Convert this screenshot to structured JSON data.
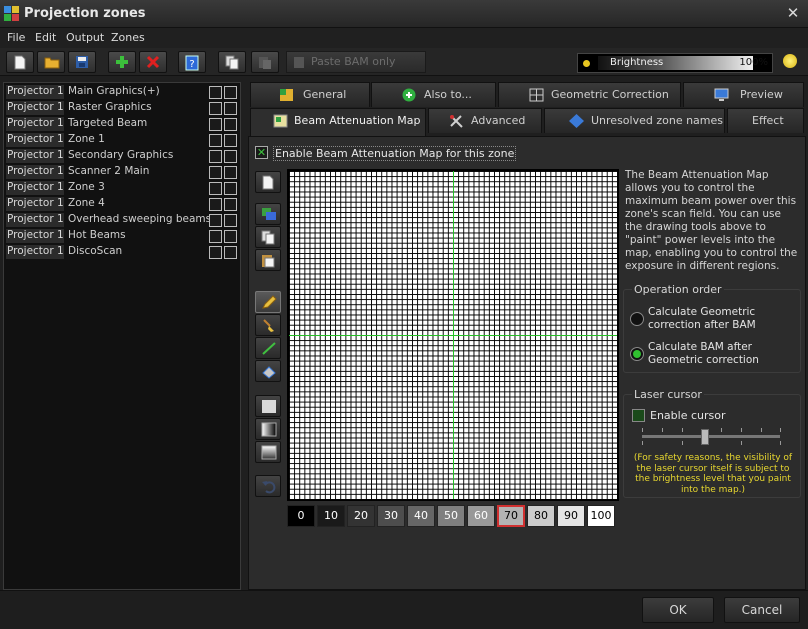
{
  "window": {
    "title": "Projection zones"
  },
  "menu": [
    "File",
    "Edit",
    "Output",
    "Zones"
  ],
  "toolbar": {
    "paste_bam_label": "Paste BAM only",
    "brightness_label": "Brightness",
    "brightness_percent": "100%",
    "brightness_value": 100
  },
  "zones": [
    {
      "projector": "Projector 1",
      "name": "Main Graphics(+)"
    },
    {
      "projector": "Projector 1",
      "name": "Raster Graphics"
    },
    {
      "projector": "Projector 1",
      "name": "Targeted Beam"
    },
    {
      "projector": "Projector 1",
      "name": "Zone 1"
    },
    {
      "projector": "Projector 1",
      "name": "Secondary Graphics"
    },
    {
      "projector": "Projector 1",
      "name": "Scanner 2 Main"
    },
    {
      "projector": "Projector 1",
      "name": "Zone 3"
    },
    {
      "projector": "Projector 1",
      "name": "Zone 4"
    },
    {
      "projector": "Projector 1",
      "name": "Overhead sweeping beams"
    },
    {
      "projector": "Projector 1",
      "name": "Hot Beams"
    },
    {
      "projector": "Projector 1",
      "name": "DiscoScan"
    }
  ],
  "tabs": {
    "row1": [
      "General",
      "Also to...",
      "Geometric Correction",
      "Preview"
    ],
    "row2": [
      "Beam Attenuation Map",
      "Advanced",
      "Unresolved zone names",
      "Effect"
    ],
    "active": "Beam Attenuation Map"
  },
  "bam": {
    "enable_label": "Enable Beam Attenuation Map for this zone",
    "enabled": true,
    "description": "The Beam Attenuation Map allows you to control the maximum beam power over this zone's scan field. You can use the drawing tools above to \"paint\" power levels into the map, enabling you to control the exposure in different regions.",
    "levels": [
      "0",
      "10",
      "20",
      "30",
      "40",
      "50",
      "60",
      "70",
      "80",
      "90",
      "100"
    ],
    "selected_level": "70"
  },
  "operation_order": {
    "title": "Operation order",
    "option1": "Calculate Geometric correction after BAM",
    "option2": "Calculate BAM after Geometric correction",
    "selected": 2
  },
  "laser_cursor": {
    "title": "Laser cursor",
    "enable_label": "Enable cursor",
    "enabled": false,
    "note": "(For safety reasons, the visibility of the laser cursor itself is subject to the brightness level that you paint into the map.)"
  },
  "buttons": {
    "ok": "OK",
    "cancel": "Cancel"
  }
}
